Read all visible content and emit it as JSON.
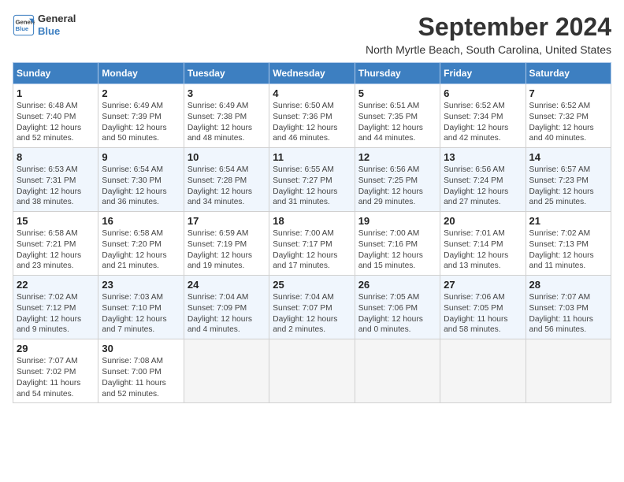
{
  "header": {
    "logo_line1": "General",
    "logo_line2": "Blue",
    "month": "September 2024",
    "location": "North Myrtle Beach, South Carolina, United States"
  },
  "weekdays": [
    "Sunday",
    "Monday",
    "Tuesday",
    "Wednesday",
    "Thursday",
    "Friday",
    "Saturday"
  ],
  "weeks": [
    [
      {
        "day": "1",
        "info": "Sunrise: 6:48 AM\nSunset: 7:40 PM\nDaylight: 12 hours\nand 52 minutes."
      },
      {
        "day": "2",
        "info": "Sunrise: 6:49 AM\nSunset: 7:39 PM\nDaylight: 12 hours\nand 50 minutes."
      },
      {
        "day": "3",
        "info": "Sunrise: 6:49 AM\nSunset: 7:38 PM\nDaylight: 12 hours\nand 48 minutes."
      },
      {
        "day": "4",
        "info": "Sunrise: 6:50 AM\nSunset: 7:36 PM\nDaylight: 12 hours\nand 46 minutes."
      },
      {
        "day": "5",
        "info": "Sunrise: 6:51 AM\nSunset: 7:35 PM\nDaylight: 12 hours\nand 44 minutes."
      },
      {
        "day": "6",
        "info": "Sunrise: 6:52 AM\nSunset: 7:34 PM\nDaylight: 12 hours\nand 42 minutes."
      },
      {
        "day": "7",
        "info": "Sunrise: 6:52 AM\nSunset: 7:32 PM\nDaylight: 12 hours\nand 40 minutes."
      }
    ],
    [
      {
        "day": "8",
        "info": "Sunrise: 6:53 AM\nSunset: 7:31 PM\nDaylight: 12 hours\nand 38 minutes."
      },
      {
        "day": "9",
        "info": "Sunrise: 6:54 AM\nSunset: 7:30 PM\nDaylight: 12 hours\nand 36 minutes."
      },
      {
        "day": "10",
        "info": "Sunrise: 6:54 AM\nSunset: 7:28 PM\nDaylight: 12 hours\nand 34 minutes."
      },
      {
        "day": "11",
        "info": "Sunrise: 6:55 AM\nSunset: 7:27 PM\nDaylight: 12 hours\nand 31 minutes."
      },
      {
        "day": "12",
        "info": "Sunrise: 6:56 AM\nSunset: 7:25 PM\nDaylight: 12 hours\nand 29 minutes."
      },
      {
        "day": "13",
        "info": "Sunrise: 6:56 AM\nSunset: 7:24 PM\nDaylight: 12 hours\nand 27 minutes."
      },
      {
        "day": "14",
        "info": "Sunrise: 6:57 AM\nSunset: 7:23 PM\nDaylight: 12 hours\nand 25 minutes."
      }
    ],
    [
      {
        "day": "15",
        "info": "Sunrise: 6:58 AM\nSunset: 7:21 PM\nDaylight: 12 hours\nand 23 minutes."
      },
      {
        "day": "16",
        "info": "Sunrise: 6:58 AM\nSunset: 7:20 PM\nDaylight: 12 hours\nand 21 minutes."
      },
      {
        "day": "17",
        "info": "Sunrise: 6:59 AM\nSunset: 7:19 PM\nDaylight: 12 hours\nand 19 minutes."
      },
      {
        "day": "18",
        "info": "Sunrise: 7:00 AM\nSunset: 7:17 PM\nDaylight: 12 hours\nand 17 minutes."
      },
      {
        "day": "19",
        "info": "Sunrise: 7:00 AM\nSunset: 7:16 PM\nDaylight: 12 hours\nand 15 minutes."
      },
      {
        "day": "20",
        "info": "Sunrise: 7:01 AM\nSunset: 7:14 PM\nDaylight: 12 hours\nand 13 minutes."
      },
      {
        "day": "21",
        "info": "Sunrise: 7:02 AM\nSunset: 7:13 PM\nDaylight: 12 hours\nand 11 minutes."
      }
    ],
    [
      {
        "day": "22",
        "info": "Sunrise: 7:02 AM\nSunset: 7:12 PM\nDaylight: 12 hours\nand 9 minutes."
      },
      {
        "day": "23",
        "info": "Sunrise: 7:03 AM\nSunset: 7:10 PM\nDaylight: 12 hours\nand 7 minutes."
      },
      {
        "day": "24",
        "info": "Sunrise: 7:04 AM\nSunset: 7:09 PM\nDaylight: 12 hours\nand 4 minutes."
      },
      {
        "day": "25",
        "info": "Sunrise: 7:04 AM\nSunset: 7:07 PM\nDaylight: 12 hours\nand 2 minutes."
      },
      {
        "day": "26",
        "info": "Sunrise: 7:05 AM\nSunset: 7:06 PM\nDaylight: 12 hours\nand 0 minutes."
      },
      {
        "day": "27",
        "info": "Sunrise: 7:06 AM\nSunset: 7:05 PM\nDaylight: 11 hours\nand 58 minutes."
      },
      {
        "day": "28",
        "info": "Sunrise: 7:07 AM\nSunset: 7:03 PM\nDaylight: 11 hours\nand 56 minutes."
      }
    ],
    [
      {
        "day": "29",
        "info": "Sunrise: 7:07 AM\nSunset: 7:02 PM\nDaylight: 11 hours\nand 54 minutes."
      },
      {
        "day": "30",
        "info": "Sunrise: 7:08 AM\nSunset: 7:00 PM\nDaylight: 11 hours\nand 52 minutes."
      },
      {
        "day": "",
        "info": ""
      },
      {
        "day": "",
        "info": ""
      },
      {
        "day": "",
        "info": ""
      },
      {
        "day": "",
        "info": ""
      },
      {
        "day": "",
        "info": ""
      }
    ]
  ]
}
